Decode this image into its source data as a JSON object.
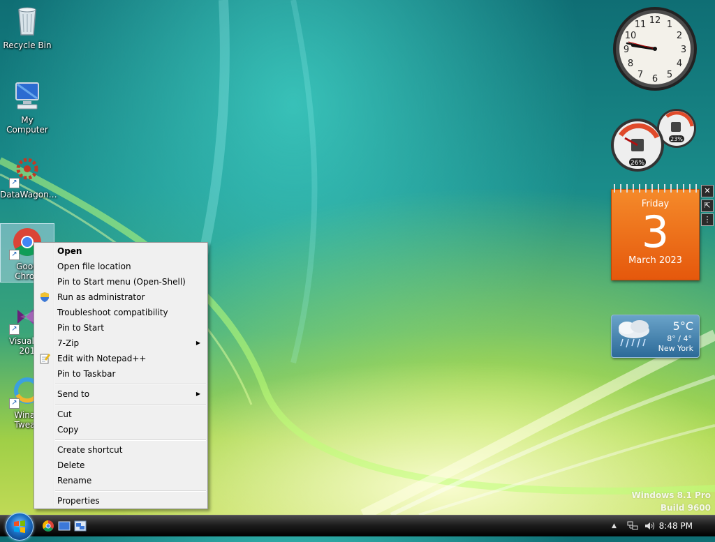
{
  "desktop": {
    "icons": [
      {
        "label": "Recycle Bin",
        "icon": "recycle-bin-icon"
      },
      {
        "label": "My Computer",
        "icon": "computer-icon"
      },
      {
        "label": "DataWagon…",
        "icon": "datawagon-icon"
      },
      {
        "label_line1": "Goog",
        "label_line2": "Chron",
        "icon": "chrome-icon"
      },
      {
        "label_line1": "Visual St",
        "label_line2": "201",
        "icon": "visual-studio-icon"
      },
      {
        "label_line1": "Winae",
        "label_line2": "Tweak",
        "icon": "winaero-tweaker-icon"
      }
    ]
  },
  "context_menu": {
    "items": [
      {
        "label": "Open",
        "bold": true
      },
      {
        "label": "Open file location"
      },
      {
        "label": "Pin to Start menu (Open-Shell)"
      },
      {
        "label": "Run as administrator",
        "icon": "uac-shield-icon"
      },
      {
        "label": "Troubleshoot compatibility"
      },
      {
        "label": "Pin to Start"
      },
      {
        "label": "7-Zip",
        "submenu": true
      },
      {
        "label": "Edit with Notepad++",
        "icon": "notepad-plus-plus-icon"
      },
      {
        "label": "Pin to Taskbar"
      },
      {
        "label": "Send to",
        "submenu": true
      },
      {
        "label": "Cut"
      },
      {
        "label": "Copy"
      },
      {
        "label": "Create shortcut"
      },
      {
        "label": "Delete"
      },
      {
        "label": "Rename"
      },
      {
        "label": "Properties"
      }
    ],
    "submenu_arrow": "▶"
  },
  "gadgets": {
    "clock": {
      "numerals": [
        "12",
        "1",
        "2",
        "3",
        "4",
        "5",
        "6",
        "7",
        "8",
        "9",
        "10",
        "11"
      ],
      "time": "8:48"
    },
    "cpu_meter": {
      "cpu_percent": "26%",
      "memory_percent": "23%"
    },
    "calendar": {
      "weekday": "Friday",
      "day": "3",
      "month_year": "March 2023"
    },
    "weather": {
      "temperature": "5°C",
      "range": "8° / 4°",
      "city": "New York",
      "condition_icon": "rain-cloud-icon"
    },
    "controls": {
      "close": "✕",
      "resize": "⇱",
      "drag": "⋮"
    }
  },
  "watermark": {
    "line1": "Windows 8.1 Pro",
    "line2": "Build 9600"
  },
  "taskbar": {
    "pinned": [
      "chrome-icon",
      "desktop-icon",
      "explorer-icon"
    ],
    "tray": {
      "show_hidden": "▲",
      "time": "8:48 PM"
    }
  }
}
